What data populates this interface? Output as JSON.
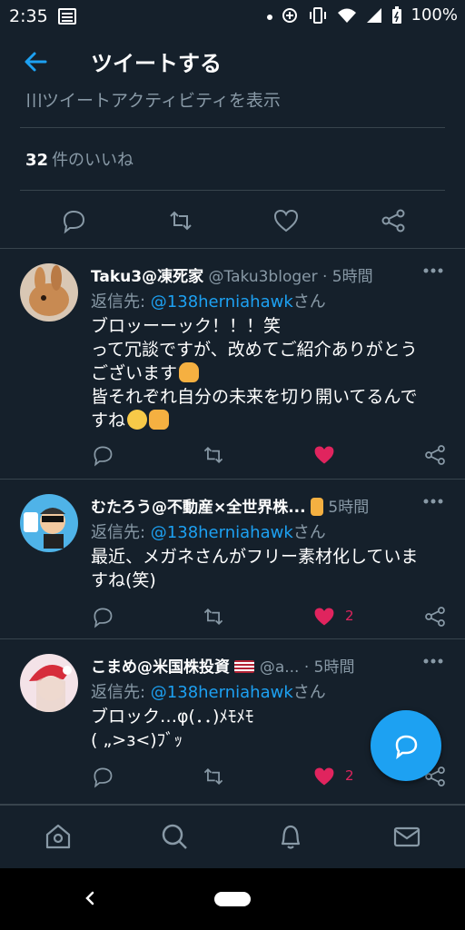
{
  "status_bar": {
    "time": "2:35",
    "battery": "100%"
  },
  "app_bar": {
    "title": "ツイートする"
  },
  "tweet": {
    "activity_text": "ツイートアクティビティを表示",
    "likes_count": "32",
    "likes_label": "件のいいね"
  },
  "replies": [
    {
      "name": "Taku3@凍死家",
      "handle": "@Taku3bloger",
      "time": "· 5時間",
      "reply_prefix": "返信先: ",
      "mention": "@138herniahawk",
      "mention_suffix": "さん",
      "body": "ブロッーーック！！！笑\nって冗談ですが、改めてご紹介ありがとう\nございます",
      "body2": "\n皆それぞれ自分の未来を切り開いてるんで\nすね",
      "likes": ""
    },
    {
      "name": "むたろう@不動産×全世界株...",
      "handle": "",
      "time": "5時間",
      "reply_prefix": "返信先: ",
      "mention": "@138herniahawk",
      "mention_suffix": "さん",
      "body": "最近、メガネさんがフリー素材化していま\nすね(笑)",
      "likes": "2"
    },
    {
      "name": "こまめ@米国株投資",
      "handle": "@a...",
      "time": "· 5時間",
      "reply_prefix": "返信先: ",
      "mention": "@138herniahawk",
      "mention_suffix": "さん",
      "body": "ブロック…φ(．．)ﾒﾓﾒﾓ\n( „>з<)ﾌﾞｯ",
      "likes": "2"
    }
  ],
  "colors": {
    "background": "#15202b",
    "accent": "#1da1f2",
    "like": "#e0245e",
    "muted": "#8899a6",
    "divider": "#38444d"
  },
  "icons": [
    "back-arrow-icon",
    "reply-icon",
    "retweet-icon",
    "like-icon",
    "share-icon",
    "more-icon",
    "compose-reply-icon",
    "home-icon",
    "search-icon",
    "notifications-icon",
    "messages-icon"
  ]
}
